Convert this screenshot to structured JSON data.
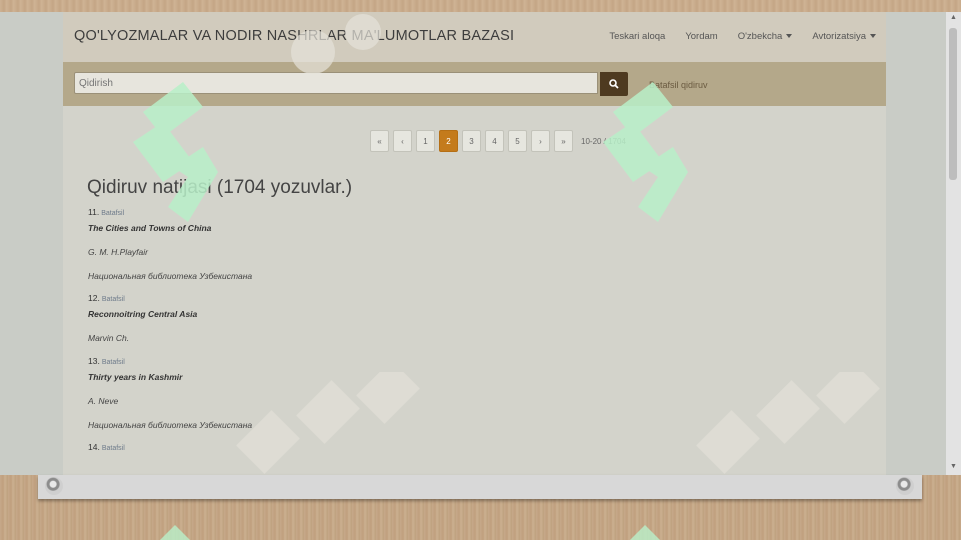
{
  "navbar": {
    "brand": "QO'LYOZMALAR VA NODIR NASHRLAR MA'LUMOTLAR BAZASI",
    "links": [
      "Teskari aloqa",
      "Yordam",
      "O'zbekcha",
      "Avtorizatsiya"
    ]
  },
  "search": {
    "placeholder": "Qidirish",
    "advanced_label": "Batafsil qidiruv",
    "button_icon": "search-icon"
  },
  "pagination": {
    "items": [
      "«",
      "‹",
      "1",
      "2",
      "3",
      "4",
      "5",
      "›",
      "»"
    ],
    "active": "2",
    "range_info": "10-20 / 1704"
  },
  "results": {
    "title": "Qidiruv natijasi (1704 yozuvlar.)",
    "items": [
      {
        "num": "11.",
        "link": "Batafsil",
        "title": "The Cities and Towns of China",
        "author": "G. M. H.Playfair",
        "library": "Национальная библиотека Узбекистана"
      },
      {
        "num": "12.",
        "link": "Batafsil",
        "title": "Reconnoitring Central Asia",
        "author": "Marvin Ch.",
        "library": ""
      },
      {
        "num": "13.",
        "link": "Batafsil",
        "title": "Thirty years in Kashmir",
        "author": "A. Neve",
        "library": "Национальная библиотека Узбекистана"
      },
      {
        "num": "14.",
        "link": "Batafsil",
        "title": "",
        "author": "",
        "library": ""
      }
    ]
  },
  "colors": {
    "navbar_bg": "#d1cbbd",
    "searchbar_bg": "#b4a88a",
    "search_button": "#4e3a20",
    "active_page": "#c47b1c"
  }
}
